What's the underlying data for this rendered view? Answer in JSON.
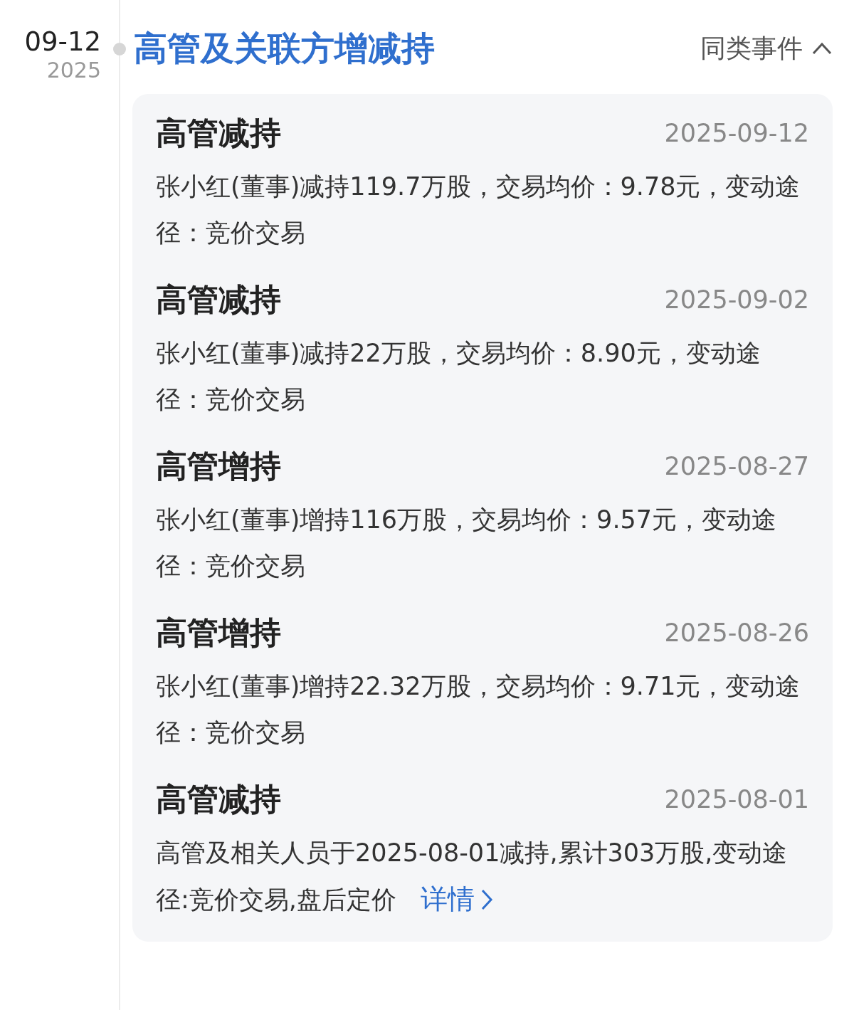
{
  "timeline_date": {
    "day": "09-12",
    "year": "2025"
  },
  "event": {
    "title": "高管及关联方增减持",
    "similar_events": {
      "label": "同类事件",
      "expanded": true
    }
  },
  "items": [
    {
      "title": "高管减持",
      "date": "2025-09-12",
      "text": "张小红(董事)减持119.7万股，交易均价：9.78元，变动途径：竞价交易"
    },
    {
      "title": "高管减持",
      "date": "2025-09-02",
      "text": "张小红(董事)减持22万股，交易均价：8.90元，变动途径：竞价交易"
    },
    {
      "title": "高管增持",
      "date": "2025-08-27",
      "text": "张小红(董事)增持116万股，交易均价：9.57元，变动途径：竞价交易"
    },
    {
      "title": "高管增持",
      "date": "2025-08-26",
      "text": "张小红(董事)增持22.32万股，交易均价：9.71元，变动途径：竞价交易"
    },
    {
      "title": "高管减持",
      "date": "2025-08-01",
      "text": "高管及相关人员于2025-08-01减持,累计303万股,变动途径:竞价交易,盘后定价",
      "link": "详情"
    }
  ]
}
